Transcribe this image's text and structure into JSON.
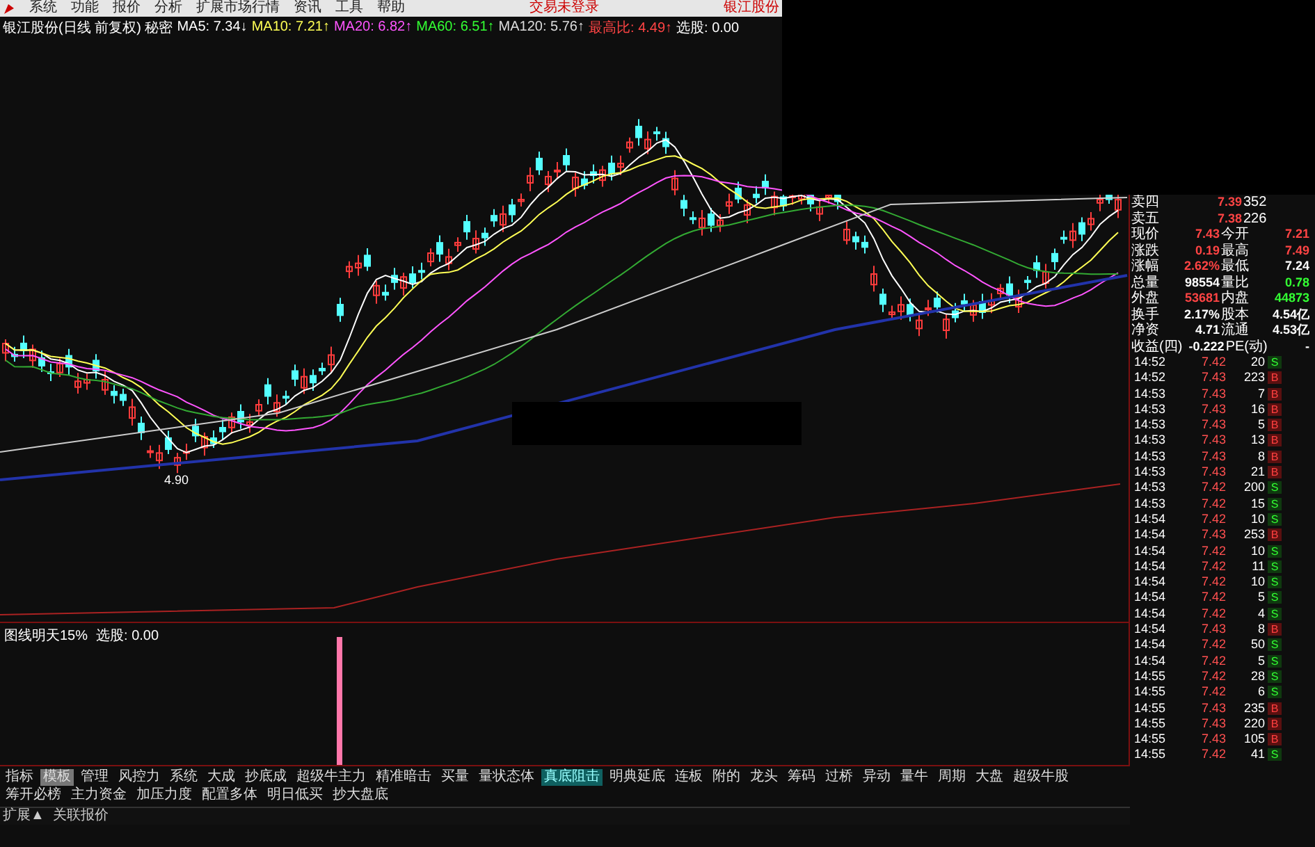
{
  "menu": {
    "items": [
      "系统",
      "功能",
      "报价",
      "分析",
      "扩展市场行情",
      "资讯",
      "工具",
      "帮助"
    ],
    "right": [
      "交易未登录",
      "银江股份"
    ]
  },
  "info_line": {
    "title": "银江股份(日线 前复权) 秘密",
    "indicators": [
      {
        "label": "MA5:",
        "value": "7.34↓",
        "color": "#ffffff"
      },
      {
        "label": "MA10:",
        "value": "7.21↑",
        "color": "#ffff55"
      },
      {
        "label": "MA20:",
        "value": "6.82↑",
        "color": "#ff55ff"
      },
      {
        "label": "MA60:",
        "value": "6.51↑",
        "color": "#33ff33"
      },
      {
        "label": "MA120:",
        "value": "5.76↑",
        "color": "#dddddd"
      },
      {
        "label": "最高比:",
        "value": "4.49↑",
        "color": "#ff4444"
      },
      {
        "label": "选股:",
        "value": "0.00",
        "color": "#ffffff"
      }
    ]
  },
  "chart": {
    "low_annotation": "4.90"
  },
  "lower_panel": {
    "title": "图线明天15%",
    "signal": "选股: 0.00"
  },
  "quote_rows": [
    [
      {
        "text": "卖四",
        "color": "#ffffff"
      },
      {
        "text": "7.39",
        "color": "#ff4444"
      },
      {
        "text": "352",
        "color": "#ffffff"
      }
    ],
    [
      {
        "text": "卖五",
        "color": "#ffffff"
      },
      {
        "text": "7.38",
        "color": "#ff4444"
      },
      {
        "text": "226",
        "color": "#ffffff"
      }
    ],
    [
      {
        "text": "现价",
        "color": "#ffffff"
      },
      {
        "text": "7.43",
        "color": "#ff4444"
      },
      {
        "text": "今开",
        "color": "#ffffff"
      },
      {
        "text": "7.21",
        "color": "#ff4444"
      }
    ],
    [
      {
        "text": "涨跌",
        "color": "#ffffff"
      },
      {
        "text": "0.19",
        "color": "#ff4444"
      },
      {
        "text": "最高",
        "color": "#ffffff"
      },
      {
        "text": "7.49",
        "color": "#ff4444"
      }
    ],
    [
      {
        "text": "涨幅",
        "color": "#ffffff"
      },
      {
        "text": "2.62%",
        "color": "#ff4444"
      },
      {
        "text": "最低",
        "color": "#ffffff"
      },
      {
        "text": "7.24",
        "color": "#ffffff"
      }
    ],
    [
      {
        "text": "总量",
        "color": "#ffffff"
      },
      {
        "text": "98554",
        "color": "#ffffff"
      },
      {
        "text": "量比",
        "color": "#ffffff"
      },
      {
        "text": "0.78",
        "color": "#33ff33"
      }
    ],
    [
      {
        "text": "外盘",
        "color": "#ffffff"
      },
      {
        "text": "53681",
        "color": "#ff4444"
      },
      {
        "text": "内盘",
        "color": "#ffffff"
      },
      {
        "text": "44873",
        "color": "#33ff33"
      }
    ],
    [
      {
        "text": "换手",
        "color": "#ffffff"
      },
      {
        "text": "2.17%",
        "color": "#ffffff"
      },
      {
        "text": "股本",
        "color": "#ffffff"
      },
      {
        "text": "4.54亿",
        "color": "#ffffff"
      }
    ],
    [
      {
        "text": "净资",
        "color": "#ffffff"
      },
      {
        "text": "4.71",
        "color": "#ffffff"
      },
      {
        "text": "流通",
        "color": "#ffffff"
      },
      {
        "text": "4.53亿",
        "color": "#ffffff"
      }
    ],
    [
      {
        "text": "收益(四)",
        "color": "#ffffff"
      },
      {
        "text": "-0.222",
        "color": "#ffffff"
      },
      {
        "text": "PE(动)",
        "color": "#ffffff"
      },
      {
        "text": "-",
        "color": "#ffffff"
      }
    ]
  ],
  "ticks": [
    {
      "time": "14:52",
      "price": "7.42",
      "volume": "20",
      "side": "S",
      "kind": "sell"
    },
    {
      "time": "14:52",
      "price": "7.43",
      "volume": "223",
      "side": "B",
      "kind": "buy"
    },
    {
      "time": "14:53",
      "price": "7.43",
      "volume": "7",
      "side": "B",
      "kind": "buy"
    },
    {
      "time": "14:53",
      "price": "7.43",
      "volume": "16",
      "side": "B",
      "kind": "buy"
    },
    {
      "time": "14:53",
      "price": "7.43",
      "volume": "5",
      "side": "B",
      "kind": "buy"
    },
    {
      "time": "14:53",
      "price": "7.43",
      "volume": "13",
      "side": "B",
      "kind": "buy"
    },
    {
      "time": "14:53",
      "price": "7.43",
      "volume": "8",
      "side": "B",
      "kind": "buy"
    },
    {
      "time": "14:53",
      "price": "7.43",
      "volume": "21",
      "side": "B",
      "kind": "buy"
    },
    {
      "time": "14:53",
      "price": "7.42",
      "volume": "200",
      "side": "S",
      "kind": "sell"
    },
    {
      "time": "14:53",
      "price": "7.42",
      "volume": "15",
      "side": "S",
      "kind": "sell"
    },
    {
      "time": "14:54",
      "price": "7.42",
      "volume": "10",
      "side": "S",
      "kind": "sell"
    },
    {
      "time": "14:54",
      "price": "7.43",
      "volume": "253",
      "side": "B",
      "kind": "buy"
    },
    {
      "time": "14:54",
      "price": "7.42",
      "volume": "10",
      "side": "S",
      "kind": "sell"
    },
    {
      "time": "14:54",
      "price": "7.42",
      "volume": "11",
      "side": "S",
      "kind": "sell"
    },
    {
      "time": "14:54",
      "price": "7.42",
      "volume": "10",
      "side": "S",
      "kind": "sell"
    },
    {
      "time": "14:54",
      "price": "7.42",
      "volume": "5",
      "side": "S",
      "kind": "sell"
    },
    {
      "time": "14:54",
      "price": "7.42",
      "volume": "4",
      "side": "S",
      "kind": "sell"
    },
    {
      "time": "14:54",
      "price": "7.43",
      "volume": "8",
      "side": "B",
      "kind": "buy"
    },
    {
      "time": "14:54",
      "price": "7.42",
      "volume": "50",
      "side": "S",
      "kind": "sell"
    },
    {
      "time": "14:54",
      "price": "7.42",
      "volume": "5",
      "side": "S",
      "kind": "sell"
    },
    {
      "time": "14:55",
      "price": "7.42",
      "volume": "28",
      "side": "S",
      "kind": "sell"
    },
    {
      "time": "14:55",
      "price": "7.42",
      "volume": "6",
      "side": "S",
      "kind": "sell"
    },
    {
      "time": "14:55",
      "price": "7.43",
      "volume": "235",
      "side": "B",
      "kind": "buy"
    },
    {
      "time": "14:55",
      "price": "7.43",
      "volume": "220",
      "side": "B",
      "kind": "buy"
    },
    {
      "time": "14:55",
      "price": "7.43",
      "volume": "105",
      "side": "B",
      "kind": "buy"
    },
    {
      "time": "14:55",
      "price": "7.42",
      "volume": "41",
      "side": "S",
      "kind": "sell"
    }
  ],
  "tabs": [
    {
      "label": "指标",
      "selected": false,
      "pressed": false
    },
    {
      "label": "模板",
      "selected": false,
      "pressed": true
    },
    {
      "label": "管理",
      "selected": false,
      "pressed": false
    },
    {
      "label": "风控力",
      "selected": false,
      "pressed": false
    },
    {
      "label": "系统",
      "selected": false,
      "pressed": false
    },
    {
      "label": "大成",
      "selected": false,
      "pressed": false
    },
    {
      "label": "抄底成",
      "selected": false,
      "pressed": false
    },
    {
      "label": "超级牛主力",
      "selected": false,
      "pressed": false
    },
    {
      "label": "精准暗击",
      "selected": false,
      "pressed": false
    },
    {
      "label": "买量",
      "selected": false,
      "pressed": false
    },
    {
      "label": "量状态体",
      "selected": false,
      "pressed": false
    },
    {
      "label": "真底阻击",
      "selected": true,
      "pressed": false
    },
    {
      "label": "明典延底",
      "selected": false,
      "pressed": false
    },
    {
      "label": "连板",
      "selected": false,
      "pressed": false
    },
    {
      "label": "附的",
      "selected": false,
      "pressed": false
    },
    {
      "label": "龙头",
      "selected": false,
      "pressed": false
    },
    {
      "label": "筹码",
      "selected": false,
      "pressed": false
    },
    {
      "label": "过桥",
      "selected": false,
      "pressed": false
    },
    {
      "label": "异动",
      "selected": false,
      "pressed": false
    },
    {
      "label": "量牛",
      "selected": false,
      "pressed": false
    },
    {
      "label": "周期",
      "selected": false,
      "pressed": false
    },
    {
      "label": "大盘",
      "selected": false,
      "pressed": false
    },
    {
      "label": "超级牛股",
      "selected": false,
      "pressed": false
    },
    {
      "label": "筹开必榜",
      "selected": false,
      "pressed": false
    },
    {
      "label": "主力资金",
      "selected": false,
      "pressed": false
    },
    {
      "label": "加压力度",
      "selected": false,
      "pressed": false
    },
    {
      "label": "配置多体",
      "selected": false,
      "pressed": false
    },
    {
      "label": "明日低买",
      "selected": false,
      "pressed": false
    },
    {
      "label": "抄大盘底",
      "selected": false,
      "pressed": false
    }
  ],
  "status_bar": [
    "扩展▲",
    "关联报价"
  ]
}
